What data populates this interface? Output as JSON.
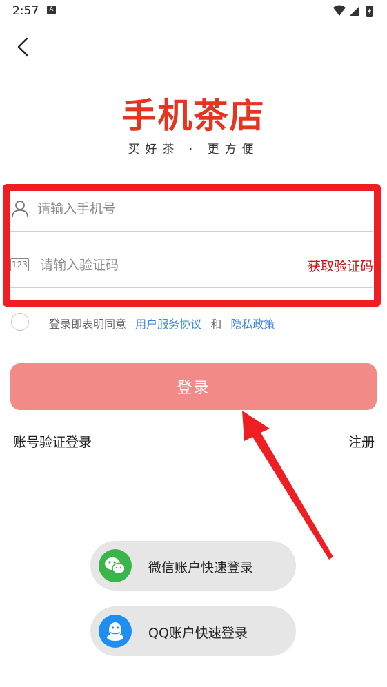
{
  "status_bar": {
    "time": "2:57",
    "notification_badge": "A"
  },
  "logo": {
    "title": "手机茶店",
    "slogan": "买好茶 · 更方便",
    "color": "#e5341f"
  },
  "phone_field": {
    "placeholder": "请输入手机号",
    "icon": "user-icon"
  },
  "code_field": {
    "placeholder": "请输入验证码",
    "icon_text": "123",
    "get_code_label": "获取验证码"
  },
  "agreement": {
    "prefix": "登录即表明同意",
    "terms_link": "用户服务协议",
    "conjunction": "和",
    "privacy_link": "隐私政策",
    "checked": false
  },
  "login_button": {
    "label": "登录",
    "color": "#f28a88"
  },
  "account_login": {
    "label": "账号验证登录"
  },
  "register": {
    "label": "注册"
  },
  "social": {
    "wechat": {
      "label": "微信账户快速登录",
      "icon": "wechat-icon",
      "color": "#39b54a"
    },
    "qq": {
      "label": "QQ账户快速登录",
      "icon": "qq-icon",
      "color": "#1e8ff0"
    }
  },
  "annotation": {
    "highlight_color": "#ee1e23"
  }
}
